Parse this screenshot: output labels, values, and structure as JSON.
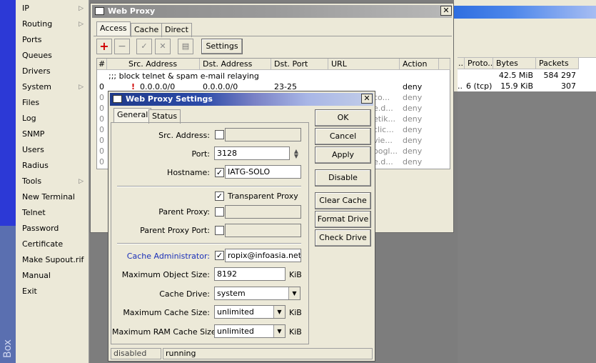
{
  "left_strip": {
    "brand": "Box"
  },
  "menu": [
    {
      "label": "IP",
      "arrow": true
    },
    {
      "label": "Routing",
      "arrow": true
    },
    {
      "label": "Ports",
      "arrow": false
    },
    {
      "label": "Queues",
      "arrow": false
    },
    {
      "label": "Drivers",
      "arrow": false
    },
    {
      "label": "System",
      "arrow": true
    },
    {
      "label": "Files",
      "arrow": false
    },
    {
      "label": "Log",
      "arrow": false
    },
    {
      "label": "SNMP",
      "arrow": false
    },
    {
      "label": "Users",
      "arrow": false
    },
    {
      "label": "Radius",
      "arrow": false
    },
    {
      "label": "Tools",
      "arrow": true
    },
    {
      "label": "New Terminal",
      "arrow": false
    },
    {
      "label": "Telnet",
      "arrow": false
    },
    {
      "label": "Password",
      "arrow": false
    },
    {
      "label": "Certificate",
      "arrow": false
    },
    {
      "label": "Make Supout.rif",
      "arrow": false
    },
    {
      "label": "Manual",
      "arrow": false
    },
    {
      "label": "Exit",
      "arrow": false
    }
  ],
  "right_panel": {
    "headers": [
      "..",
      "Proto...",
      "Bytes",
      "Packets"
    ],
    "rows": [
      {
        "dots": "",
        "proto": "",
        "bytes": "42.5 MiB",
        "packets": "584 297"
      },
      {
        "dots": "..",
        "proto": "6 (tcp)",
        "bytes": "15.9 KiB",
        "packets": "307"
      }
    ]
  },
  "web_proxy": {
    "title": "Web Proxy",
    "close": "✕",
    "tabs": [
      "Access",
      "Cache",
      "Direct"
    ],
    "toolbar": {
      "add": "+",
      "remove": "−",
      "enable": "✓",
      "disable": "✕",
      "comment": "▤",
      "settings": "Settings"
    },
    "columns": [
      "#",
      "Src. Address",
      "Dst. Address",
      "Dst. Port",
      "URL",
      "Action"
    ],
    "comment_row": ";;; block telnet & spam e-mail relaying",
    "rows": [
      {
        "num": "0",
        "src": "0.0.0.0/0",
        "dst": "0.0.0.0/0",
        "port": "23-25",
        "url": "",
        "action": "deny"
      },
      {
        "num": "0",
        "src": "",
        "dst": "",
        "port": "",
        "url": "..co...",
        "action": "deny"
      },
      {
        "num": "0",
        "src": "",
        "dst": "",
        "port": "",
        "url": "..e.d...",
        "action": "deny"
      },
      {
        "num": "0",
        "src": "",
        "dst": "",
        "port": "",
        "url": "..etik...",
        "action": "deny"
      },
      {
        "num": "0",
        "src": "",
        "dst": "",
        "port": "",
        "url": "..clic...",
        "action": "deny"
      },
      {
        "num": "0",
        "src": "",
        "dst": "",
        "port": "",
        "url": "..vie...",
        "action": "deny"
      },
      {
        "num": "0",
        "src": "",
        "dst": "",
        "port": "",
        "url": "..oogl...",
        "action": "deny"
      },
      {
        "num": "0",
        "src": "",
        "dst": "",
        "port": "",
        "url": "..e.d...",
        "action": "deny"
      }
    ]
  },
  "settings": {
    "title": "Web Proxy Settings",
    "close": "✕",
    "tabs": [
      "General",
      "Status"
    ],
    "buttons": [
      "OK",
      "Cancel",
      "Apply",
      "Disable",
      "Clear Cache",
      "Format Drive",
      "Check Drive"
    ],
    "fields": {
      "src_address": {
        "label": "Src. Address:",
        "value": "",
        "checked": false
      },
      "port": {
        "label": "Port:",
        "value": "3128"
      },
      "hostname": {
        "label": "Hostname:",
        "value": "IATG-SOLO",
        "checked": true
      },
      "transparent": {
        "label": "Transparent Proxy",
        "checked": true
      },
      "parent_proxy": {
        "label": "Parent Proxy:",
        "value": "",
        "checked": false
      },
      "parent_proxy_port": {
        "label": "Parent Proxy Port:",
        "value": "",
        "checked": false
      },
      "cache_admin": {
        "label": "Cache Administrator:",
        "value": "ropix@infoasia.net",
        "checked": true
      },
      "max_object": {
        "label": "Maximum Object Size:",
        "value": "8192",
        "unit": "KiB"
      },
      "cache_drive": {
        "label": "Cache Drive:",
        "value": "system"
      },
      "max_cache": {
        "label": "Maximum Cache Size:",
        "value": "unlimited",
        "unit": "KiB"
      },
      "max_ram": {
        "label": "Maximum RAM Cache Size:",
        "value": "unlimited",
        "unit": "KiB"
      }
    },
    "status_left": "disabled",
    "status_right": "running",
    "colors": {
      "cache_admin_label": "#1a2fb8"
    }
  }
}
